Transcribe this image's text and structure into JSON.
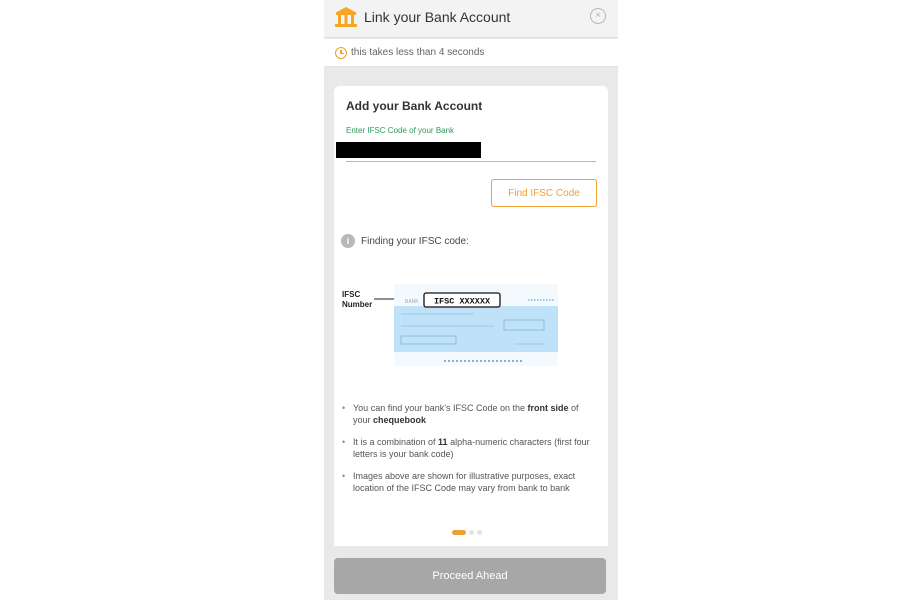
{
  "header": {
    "title": "Link your Bank Account",
    "icon": "bank-icon",
    "close_icon": "×"
  },
  "subheader": {
    "text": "this takes less than 4 seconds"
  },
  "card": {
    "title": "Add your Bank Account",
    "ifsc_label": "Enter IFSC Code of your Bank",
    "ifsc_value": "",
    "find_button_label": "Find IFSC Code",
    "finding_text": "Finding your IFSC code:",
    "info_icon": "i",
    "cheque": {
      "side_label_line1": "IFSC",
      "side_label_line2": "Number",
      "highlight_text": "IFSC XXXXXX",
      "bank_text": "BANK"
    },
    "bullets": {
      "b1_prefix": "You can find your bank's IFSC Code on the ",
      "b1_bold1": "front side",
      "b1_mid": " of your ",
      "b1_bold2": "chequebook",
      "b2_prefix": "It is a combination of ",
      "b2_bold": "11",
      "b2_suffix": " alpha-numeric characters (first four letters is your bank code)",
      "b3": "Images above are shown for illustrative purposes, exact location of the IFSC Code may vary from bank to bank"
    }
  },
  "carousel": {
    "active_index": 0,
    "count": 3
  },
  "footer": {
    "proceed_label": "Proceed Ahead"
  },
  "colors": {
    "accent_orange": "#f0a030",
    "accent_green": "#2e9a5a",
    "cheque_blue": "#bfe2f8",
    "disabled_button": "#a7a7a7"
  }
}
